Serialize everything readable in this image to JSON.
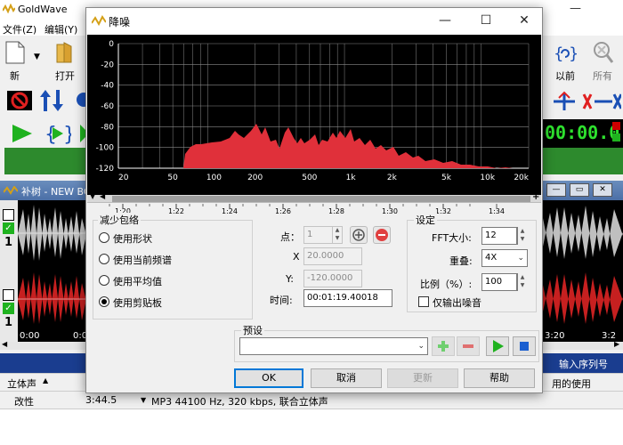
{
  "app": {
    "title": "GoldWave",
    "menu": [
      "文件(Z)",
      "编辑(Y)"
    ],
    "toolbar_left_labels": [
      "新",
      "打开"
    ],
    "toolbar_right_labels": [
      "以前",
      "所有"
    ],
    "counter": "00:00.0",
    "doc_title": "补树 - NEW BC",
    "wave_time_labels": [
      "0:00",
      "0:0",
      "3:20",
      "3:2"
    ],
    "sequence_label": "输入序列号",
    "status": {
      "channel": "立体声",
      "length": "3:44.5",
      "modified": "改性",
      "format": "MP3 44100 Hz, 320 kbps, 联合立体声",
      "usage": "用的使用"
    }
  },
  "dialog": {
    "title": "降噪",
    "window_buttons": {
      "minimize": "—",
      "maximize": "☐",
      "close": "✕"
    },
    "spectrum": {
      "y_ticks": [
        "0",
        "-20",
        "-40",
        "-60",
        "-80",
        "-100",
        "-120"
      ],
      "x_ticks": [
        "20",
        "50",
        "100",
        "200",
        "500",
        "1k",
        "2k",
        "5k",
        "10k",
        "20k"
      ],
      "fill_color": "#e0303a",
      "background": "#000000",
      "grid_color": "#8a8a8a"
    },
    "ruler_ticks": [
      "1:20",
      "1:22",
      "1:24",
      "1:26",
      "1:28",
      "1:30",
      "1:32",
      "1:34"
    ],
    "reduce_group": {
      "label": "减少包络",
      "options": [
        {
          "label": "使用形状",
          "checked": false
        },
        {
          "label": "使用当前频谱",
          "checked": false
        },
        {
          "label": "使用平均值",
          "checked": false
        },
        {
          "label": "使用剪贴板",
          "checked": true
        }
      ]
    },
    "point": {
      "label": "点：",
      "value": "1",
      "x_label": "X",
      "x_value": "20.0000",
      "y_label": "Y:",
      "y_value": "-120.0000",
      "time_label": "时间:",
      "time_value": "00:01:19.40018"
    },
    "settings_group": {
      "label": "设定",
      "fft_label": "FFT大小:",
      "fft_value": "12",
      "overlap_label": "重叠:",
      "overlap_value": "4X",
      "ratio_label": "比例（%）:",
      "ratio_value": "100",
      "output_noise_label": "仅输出噪音",
      "output_noise_checked": false
    },
    "preset": {
      "label": "预设",
      "value": ""
    },
    "buttons": {
      "ok": "OK",
      "cancel": "取消",
      "update": "更新",
      "help": "帮助"
    }
  }
}
